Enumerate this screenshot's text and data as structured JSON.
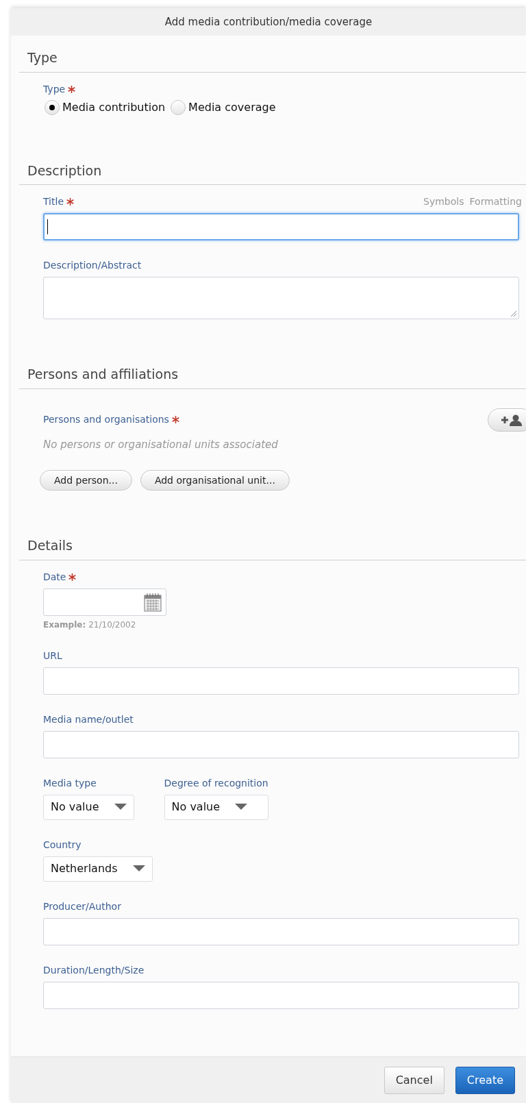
{
  "dialog": {
    "title": "Add media contribution/media coverage"
  },
  "sections": [
    {
      "heading": "Type",
      "fields": [
        {
          "kind": "radio",
          "label": "Type",
          "required": true,
          "options": [
            {
              "label": "Media contribution",
              "selected": true
            },
            {
              "label": "Media coverage",
              "selected": false
            }
          ]
        }
      ]
    },
    {
      "heading": "Description",
      "fields": [
        {
          "kind": "text",
          "label": "Title",
          "required": true,
          "focused": true,
          "links": [
            "Symbols",
            "Formatting"
          ]
        },
        {
          "kind": "textarea",
          "label": "Description/Abstract",
          "required": false
        }
      ]
    },
    {
      "heading": "Persons and affiliations",
      "fields": [
        {
          "kind": "persons",
          "label": "Persons and organisations",
          "required": true,
          "empty_text": "No persons or organisational units associated",
          "buttons": [
            "Add person...",
            "Add organisational unit..."
          ]
        }
      ]
    },
    {
      "heading": "Details",
      "fields": [
        {
          "kind": "date",
          "label": "Date",
          "required": true,
          "example_label": "Example:",
          "example_value": "21/10/2002"
        },
        {
          "kind": "text",
          "label": "URL",
          "required": false,
          "focused": false
        },
        {
          "kind": "text",
          "label": "Media name/outlet",
          "required": false,
          "focused": false
        },
        {
          "kind": "select_group",
          "selects": [
            {
              "label": "Media type",
              "value": "No value"
            },
            {
              "label": "Degree of recognition",
              "value": "No value"
            }
          ]
        },
        {
          "kind": "select_group",
          "selects": [
            {
              "label": "Country",
              "value": "Netherlands"
            }
          ]
        },
        {
          "kind": "text",
          "label": "Producer/Author",
          "required": false,
          "focused": false
        },
        {
          "kind": "text",
          "label": "Duration/Length/Size",
          "required": false,
          "focused": false
        }
      ]
    }
  ],
  "footer": {
    "buttons": [
      {
        "label": "Cancel",
        "primary": false
      },
      {
        "label": "Create",
        "primary": true
      }
    ]
  }
}
